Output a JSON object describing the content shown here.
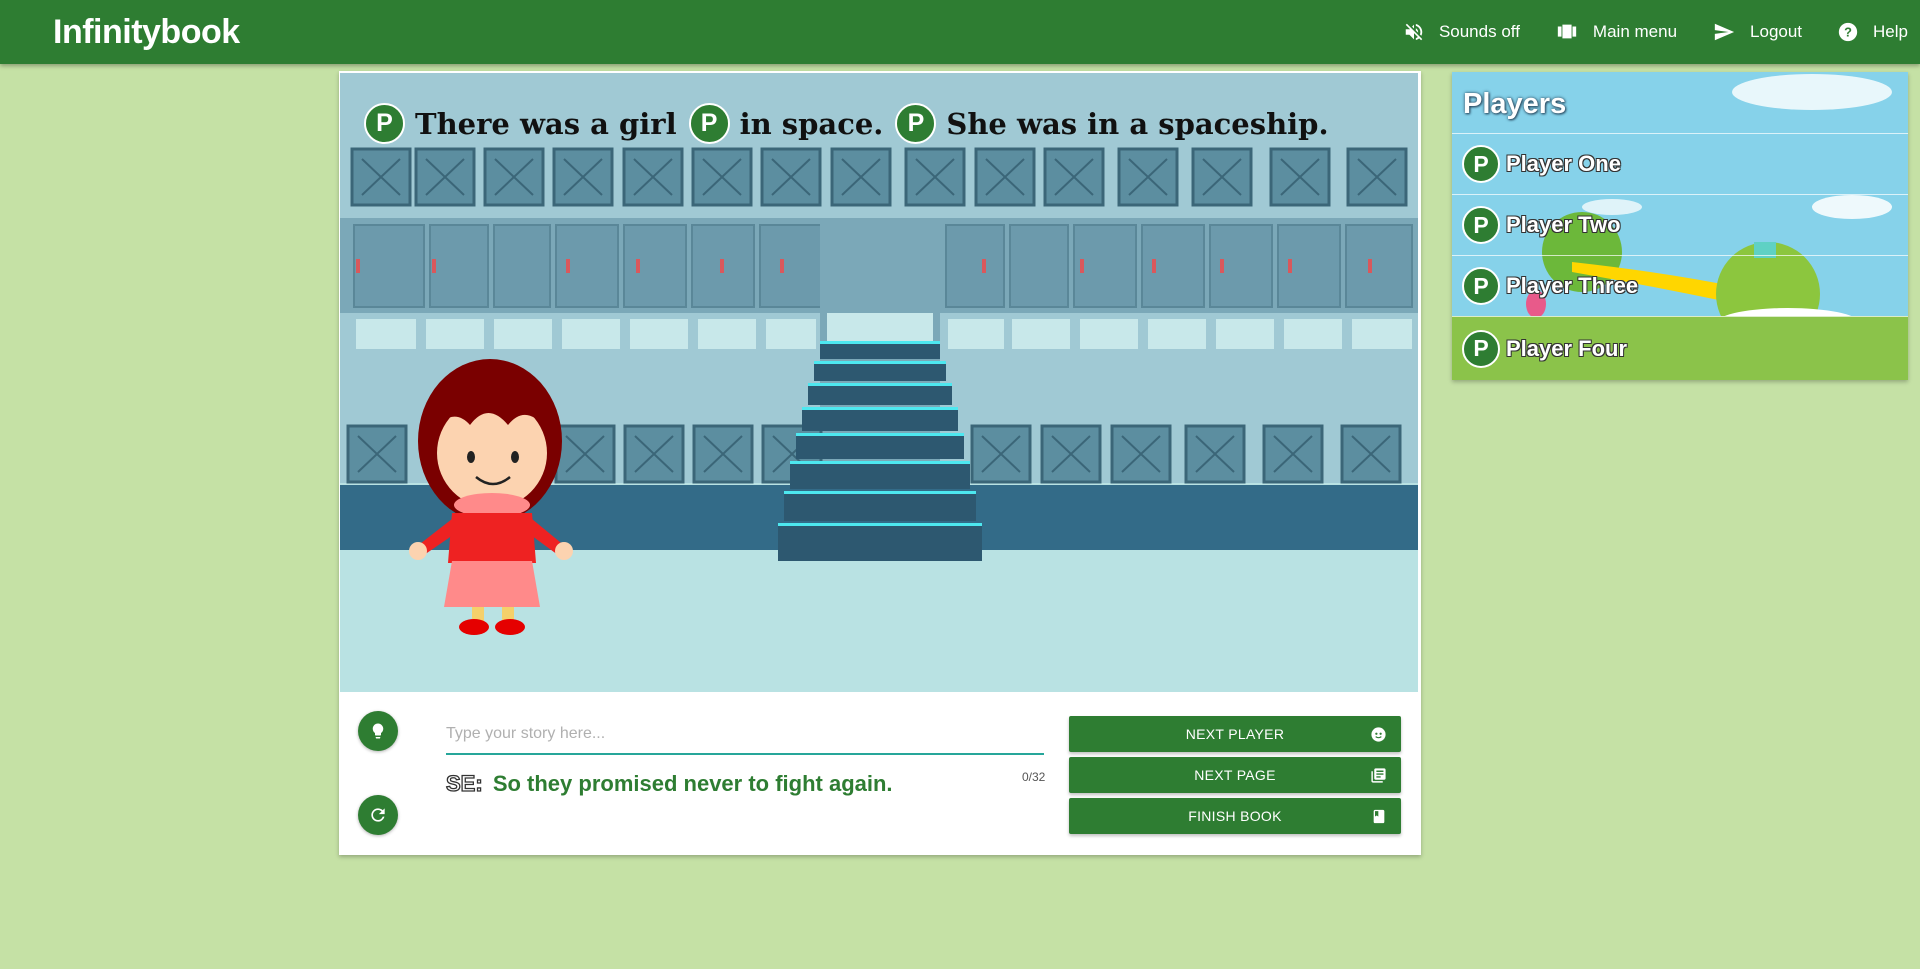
{
  "app": {
    "title": "Infinitybook"
  },
  "nav": {
    "sounds_label": "Sounds off",
    "main_menu_label": "Main menu",
    "logout_label": "Logout",
    "help_label": "Help"
  },
  "story": {
    "badge_letter": "P",
    "segments": [
      "There was a girl",
      "in space.",
      "She was in a spaceship."
    ]
  },
  "editor": {
    "placeholder": "Type your story here...",
    "value": "",
    "counter": "0/32",
    "se_tag": "SE:",
    "se_text": "So they promised never to fight again."
  },
  "actions": {
    "next_player": "NEXT PLAYER",
    "next_page": "NEXT PAGE",
    "finish_book": "FINISH BOOK"
  },
  "players": {
    "title": "Players",
    "badge_letter": "P",
    "items": [
      {
        "name": "Player One",
        "active": false
      },
      {
        "name": "Player Two",
        "active": false
      },
      {
        "name": "Player Three",
        "active": false
      },
      {
        "name": "Player Four",
        "active": true
      }
    ]
  },
  "colors": {
    "header": "#2e7d32",
    "page_bg": "#c5e1a5",
    "accent_underline": "#26a69a",
    "active_player": "#8bc34a"
  }
}
